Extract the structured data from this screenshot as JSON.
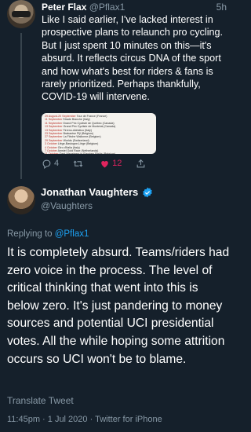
{
  "quoted_tweet": {
    "name": "Peter Flax",
    "handle": "@Pflax1",
    "time": "5h",
    "text": "Like I said earlier, I've lacked interest in prospective plans to relaunch pro cycling. But I just spent 10 minutes on this—it's absurd. It reflects circus DNA of the sport and how what's best for riders & fans is rarely prioritized. Perhaps thankfully, COVID-19 will intervene.",
    "embedded_calendar": [
      {
        "date": "29 August-20 September",
        "race": "Tour de France (France)"
      },
      {
        "date": "11 September",
        "race": "Strade Bianche (Italy)"
      },
      {
        "date": "11 September",
        "race": "Grand Prix Cycliste de Québec (Canada)"
      },
      {
        "date": "13 September",
        "race": "Grand Prix Cycliste de Montréal (Canada)"
      },
      {
        "date": "13 September",
        "race": "Tirreno-Adriatico (Italy)"
      },
      {
        "date": "23 September",
        "race": "Brabantse Pijl (Belgium)"
      },
      {
        "date": "27 September",
        "race": "La Flèche Wallonne (Belgium)"
      },
      {
        "date": "29 September",
        "race": "Worlds (Switzerland)"
      },
      {
        "date": "3 October",
        "race": "Liège-Bastogne-Liège (Belgium)"
      },
      {
        "date": "4 October",
        "race": "Giro d'Italia (Italy)"
      },
      {
        "date": "7 October",
        "race": "Amstel Gold Race (Netherlands)"
      },
      {
        "date": "11 October",
        "race": "Gent-Wevelgem in Flanders Fields (Belgium)"
      },
      {
        "date": "18 October",
        "race": "Ronde van Vlaanderen (Belgium)"
      },
      {
        "date": "20 October",
        "race": "Paris-Roubaix (France)"
      },
      {
        "date": "25 October",
        "race": "Il Lombardia (Italy)"
      },
      {
        "date": "8 November",
        "race": "Vuelta a España (Spain)"
      }
    ],
    "replies": "4",
    "retweets": "",
    "likes": "12"
  },
  "main_tweet": {
    "name": "Jonathan Vaughters",
    "handle": "@Vaughters",
    "replying_prefix": "Replying to ",
    "replying_to": "@Pflax1",
    "text": "It is completely absurd. Teams/riders had zero voice in the process. The level of critical thinking that went into this is below zero. It's just pandering to money sources and potential UCI presidential votes. All the while hoping some attrition occurs so UCI won't be to blame.",
    "translate": "Translate Tweet",
    "meta": "11:45pm · 1 Jul 2020 · Twitter for iPhone"
  },
  "colors": {
    "background": "#15202b",
    "secondary_text": "#8899a6",
    "link": "#1da1f2",
    "like": "#e0245e"
  }
}
